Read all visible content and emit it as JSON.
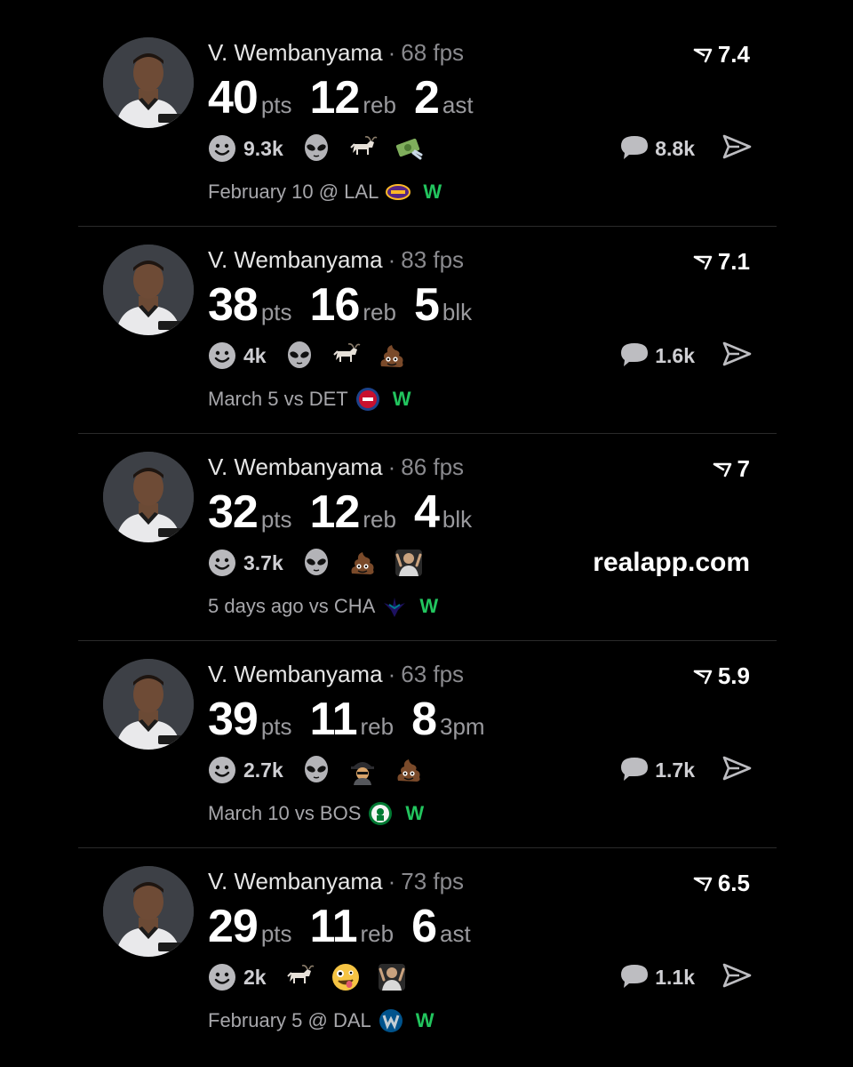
{
  "posts": [
    {
      "player": "V. Wembanyama",
      "sep": "·",
      "fps": "68 fps",
      "rating": "7.4",
      "stats": [
        {
          "value": "40",
          "unit": "pts"
        },
        {
          "value": "12",
          "unit": "reb"
        },
        {
          "value": "2",
          "unit": "ast"
        }
      ],
      "reaction_count": "9.3k",
      "reactions": [
        "alien-icon",
        "goat-icon",
        "money-icon"
      ],
      "comments": "8.8k",
      "date": "February 10 @ LAL",
      "team": "lakers-logo-icon",
      "result": "W"
    },
    {
      "player": "V. Wembanyama",
      "sep": "·",
      "fps": "83 fps",
      "rating": "7.1",
      "stats": [
        {
          "value": "38",
          "unit": "pts"
        },
        {
          "value": "16",
          "unit": "reb"
        },
        {
          "value": "5",
          "unit": "blk"
        }
      ],
      "reaction_count": "4k",
      "reactions": [
        "alien-icon",
        "goat-icon",
        "poop-icon"
      ],
      "comments": "1.6k",
      "date": "March 5 vs DET",
      "team": "pistons-logo-icon",
      "result": "W"
    },
    {
      "player": "V. Wembanyama",
      "sep": "·",
      "fps": "86 fps",
      "rating": "7",
      "stats": [
        {
          "value": "32",
          "unit": "pts"
        },
        {
          "value": "12",
          "unit": "reb"
        },
        {
          "value": "4",
          "unit": "blk"
        }
      ],
      "reaction_count": "3.7k",
      "reactions": [
        "alien-icon",
        "poop-icon",
        "person-icon"
      ],
      "promo": "realapp.com",
      "date": "5 days ago vs CHA",
      "team": "hornets-logo-icon",
      "result": "W"
    },
    {
      "player": "V. Wembanyama",
      "sep": "·",
      "fps": "63 fps",
      "rating": "5.9",
      "stats": [
        {
          "value": "39",
          "unit": "pts"
        },
        {
          "value": "11",
          "unit": "reb"
        },
        {
          "value": "8",
          "unit": "3pm"
        }
      ],
      "reaction_count": "2.7k",
      "reactions": [
        "alien-icon",
        "detective-icon",
        "poop-icon"
      ],
      "comments": "1.7k",
      "date": "March 10 vs BOS",
      "team": "celtics-logo-icon",
      "result": "W"
    },
    {
      "player": "V. Wembanyama",
      "sep": "·",
      "fps": "73 fps",
      "rating": "6.5",
      "stats": [
        {
          "value": "29",
          "unit": "pts"
        },
        {
          "value": "11",
          "unit": "reb"
        },
        {
          "value": "6",
          "unit": "ast"
        }
      ],
      "reaction_count": "2k",
      "reactions": [
        "goat-icon",
        "zany-face-icon",
        "person-icon"
      ],
      "comments": "1.1k",
      "date": "February 5 @ DAL",
      "team": "mavericks-logo-icon",
      "result": "W"
    }
  ],
  "colors": {
    "background": "#000000",
    "win": "#22c55e",
    "muted": "#8a8a8e",
    "text": "#ffffff"
  }
}
